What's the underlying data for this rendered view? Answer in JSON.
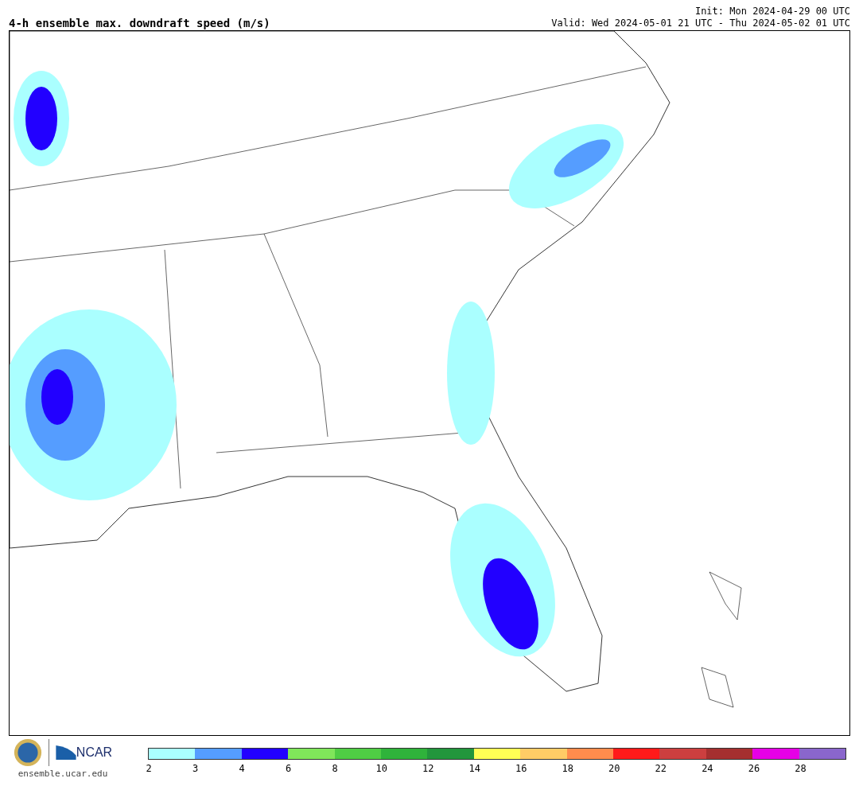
{
  "title": "4-h ensemble max. downdraft speed (m/s)",
  "init": "Init: Mon 2024-04-29 00 UTC",
  "valid": "Valid: Wed 2024-05-01 21 UTC - Thu 2024-05-02 01 UTC",
  "logos": {
    "agency": "NCAR",
    "url": "ensemble.ucar.edu"
  },
  "colorbar": {
    "bins": [
      {
        "color": "#aaffff"
      },
      {
        "color": "#559dff"
      },
      {
        "color": "#2200ff"
      },
      {
        "color": "#80e65a"
      },
      {
        "color": "#4fcd44"
      },
      {
        "color": "#2fb33b"
      },
      {
        "color": "#22963c"
      },
      {
        "color": "#ffff55"
      },
      {
        "color": "#ffcc66"
      },
      {
        "color": "#ff8c4d"
      },
      {
        "color": "#ff1a1a"
      },
      {
        "color": "#cc3f3f"
      },
      {
        "color": "#a52f2f"
      },
      {
        "color": "#e600e6"
      },
      {
        "color": "#8a66cc"
      }
    ],
    "ticks": [
      "2",
      "3",
      "4",
      "6",
      "8",
      "10",
      "12",
      "14",
      "16",
      "18",
      "20",
      "22",
      "24",
      "26",
      "28"
    ]
  }
}
